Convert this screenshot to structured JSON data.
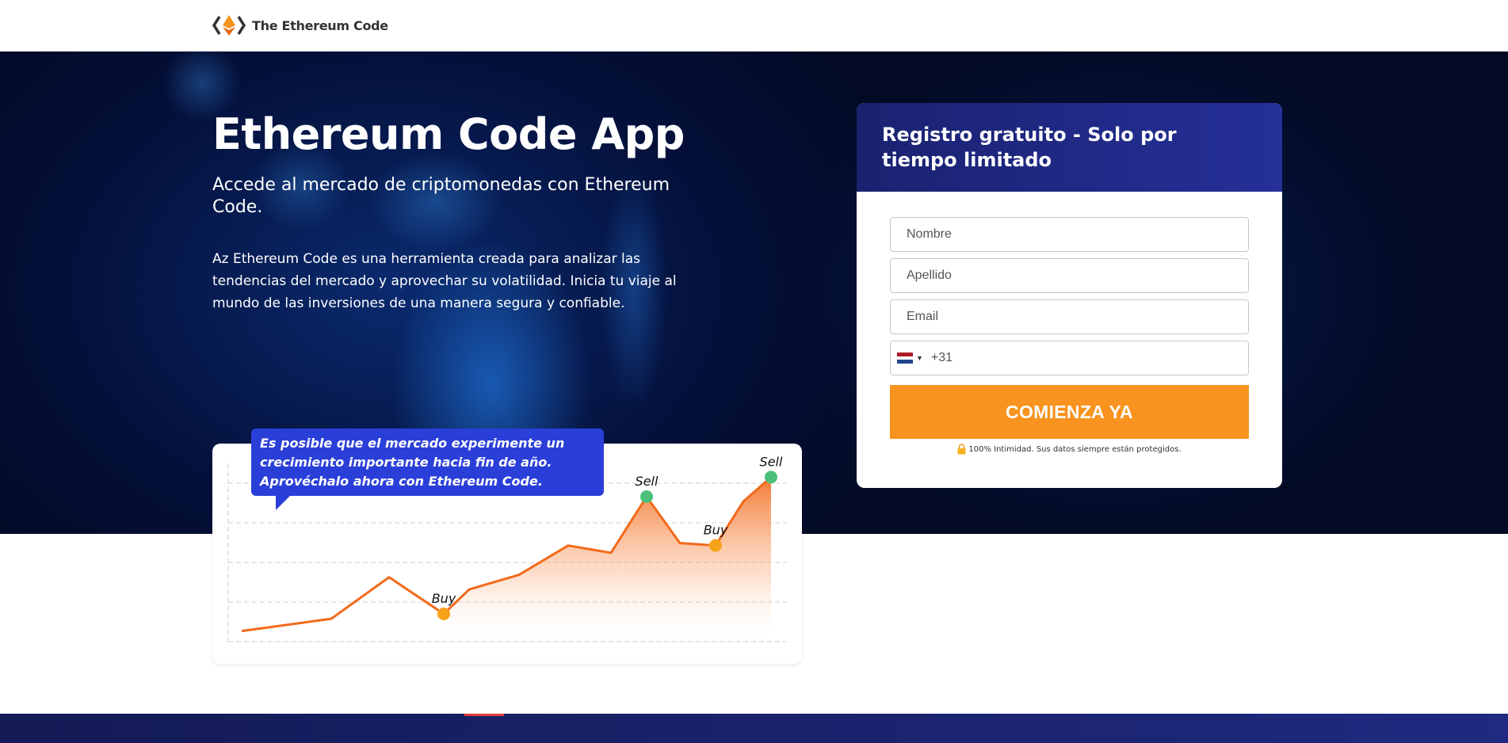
{
  "header": {
    "brand": "The Ethereum Code"
  },
  "hero": {
    "title": "Ethereum Code App",
    "subtitle": "Accede al mercado de criptomonedas con Ethereum Code.",
    "description": "Az Ethereum Code es una herramienta creada para analizar las tendencias del mercado y aprovechar su volatilidad. Inicia tu viaje al mundo de las inversiones de una manera segura y confiable."
  },
  "chart_callout": "Es posible que el mercado experimente un crecimiento importante hacia fin de año. Aprovéchalo ahora con Ethereum Code.",
  "chart_data": {
    "type": "line",
    "x": [
      0,
      1,
      2,
      3,
      4,
      5,
      6,
      7,
      8,
      9,
      10,
      11,
      12
    ],
    "values": [
      5,
      10,
      27,
      12,
      22,
      28,
      40,
      37,
      60,
      41,
      40,
      58,
      68
    ],
    "ylim": [
      0,
      72
    ],
    "grid": true,
    "annotations": [
      {
        "label": "Buy",
        "index": 3,
        "kind": "buy"
      },
      {
        "label": "Sell",
        "index": 8,
        "kind": "sell"
      },
      {
        "label": "Buy",
        "index": 10,
        "kind": "buy"
      },
      {
        "label": "Sell",
        "index": 12,
        "kind": "sell"
      }
    ],
    "colors": {
      "line": "#f26a1b",
      "buy": "#f7a21b",
      "sell": "#4cc07a"
    }
  },
  "form": {
    "title": "Registro gratuito - Solo por tiempo limitado",
    "first_name_placeholder": "Nombre",
    "last_name_placeholder": "Apellido",
    "email_placeholder": "Email",
    "phone_prefix": "+31",
    "submit_label": "COMIENZA YA",
    "privacy_note": "100% Intimidad. Sus datos siempre están protegidos."
  },
  "colors": {
    "accent": "#f7931e",
    "form_header": "#1f2a85",
    "callout": "#2a3fd8"
  }
}
